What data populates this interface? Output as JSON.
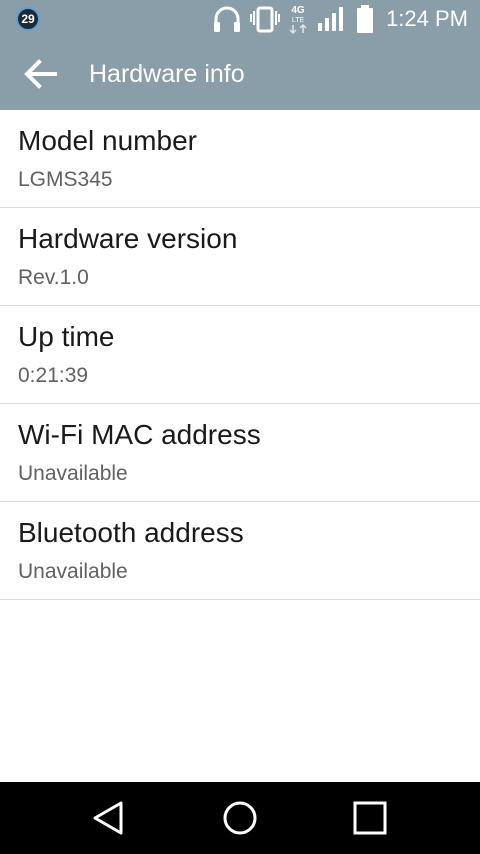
{
  "status_bar": {
    "notification_count": "29",
    "time": "1:24 PM",
    "network_label_top": "4G",
    "network_label_bottom": "LTE",
    "icons": [
      "headphones-icon",
      "vibrate-icon",
      "network-4g-lte-icon",
      "signal-icon",
      "battery-icon"
    ]
  },
  "app_bar": {
    "title": "Hardware info",
    "back_icon": "back-arrow-icon"
  },
  "items": [
    {
      "title": "Model number",
      "value": "LGMS345"
    },
    {
      "title": "Hardware version",
      "value": "Rev.1.0"
    },
    {
      "title": "Up time",
      "value": "0:21:39"
    },
    {
      "title": "Wi-Fi MAC address",
      "value": "Unavailable"
    },
    {
      "title": "Bluetooth address",
      "value": "Unavailable"
    }
  ],
  "nav_bar": {
    "icons": [
      "back-triangle-icon",
      "home-circle-icon",
      "recents-square-icon"
    ]
  },
  "colors": {
    "app_bar": "#8a9ea9",
    "nav_bar": "#000000",
    "divider": "#d9d9d9",
    "title_text": "#1a1a1a",
    "value_text": "#616161"
  }
}
